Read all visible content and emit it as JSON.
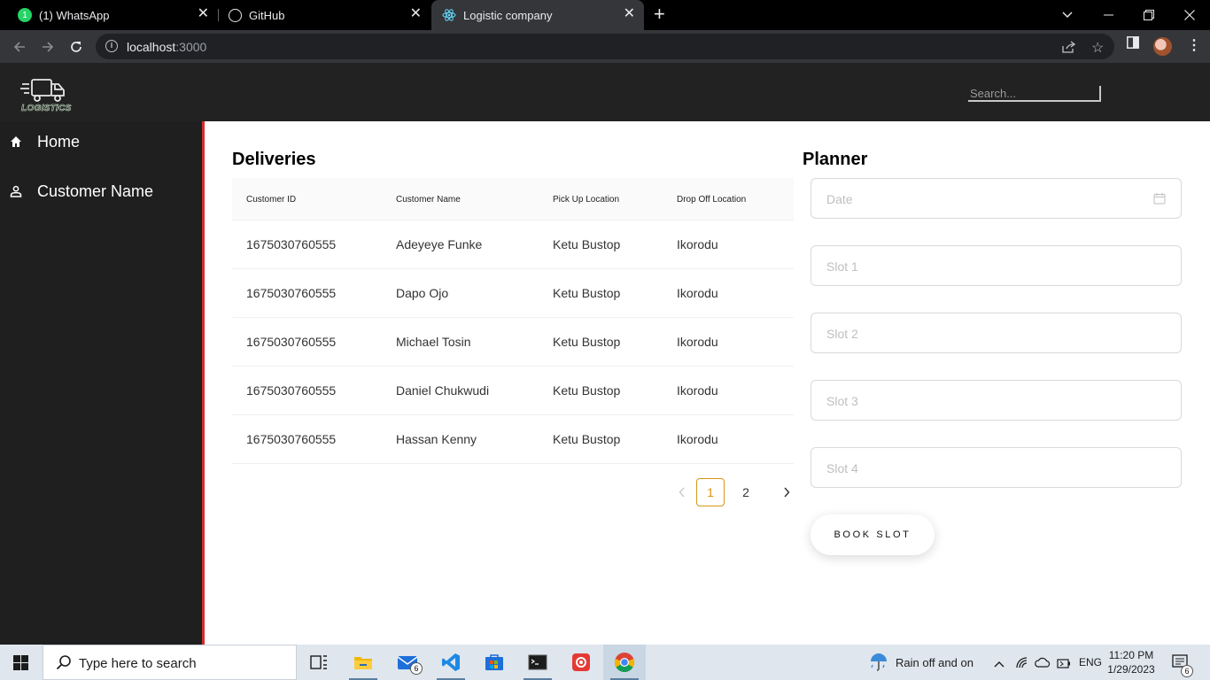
{
  "browser": {
    "tabs": [
      {
        "title": "(1) WhatsApp",
        "icon": "whatsapp-icon"
      },
      {
        "title": "GitHub",
        "icon": "github-icon"
      },
      {
        "title": "Logistic company",
        "icon": "react-icon",
        "active": true
      }
    ],
    "url_host": "localhost",
    "url_port": ":3000"
  },
  "app": {
    "logo_text": "LOGISTICS",
    "search_placeholder": "Search...",
    "sidebar": [
      {
        "label": "Home",
        "icon": "home-icon"
      },
      {
        "label": "Customer Name",
        "icon": "user-icon"
      }
    ],
    "deliveries": {
      "title": "Deliveries",
      "columns": [
        "Customer ID",
        "Customer Name",
        "Pick Up Location",
        "Drop Off Location"
      ],
      "rows": [
        [
          "1675030760555",
          "Adeyeye Funke",
          "Ketu Bustop",
          "Ikorodu"
        ],
        [
          "1675030760555",
          "Dapo Ojo",
          "Ketu Bustop",
          "Ikorodu"
        ],
        [
          "1675030760555",
          "Michael Tosin",
          "Ketu Bustop",
          "Ikorodu"
        ],
        [
          "1675030760555",
          "Daniel Chukwudi",
          "Ketu Bustop",
          "Ikorodu"
        ],
        [
          "1675030760555",
          "Hassan Kenny",
          "Ketu Bustop",
          "Ikorodu"
        ]
      ],
      "pagination": {
        "pages": [
          "1",
          "2"
        ],
        "current": "1"
      }
    },
    "planner": {
      "title": "Planner",
      "date_placeholder": "Date",
      "slots": [
        "Slot 1",
        "Slot 2",
        "Slot 3",
        "Slot 4"
      ],
      "book_label": "BOOK SLOT"
    },
    "accent_color": "#d89614",
    "sidebar_border_color": "#d32f2f"
  },
  "taskbar": {
    "search_text": "Type here to search",
    "mail_badge": "6",
    "weather": "Rain off and on",
    "lang": "ENG",
    "time": "11:20 PM",
    "date": "1/29/2023",
    "notif_badge": "6"
  }
}
